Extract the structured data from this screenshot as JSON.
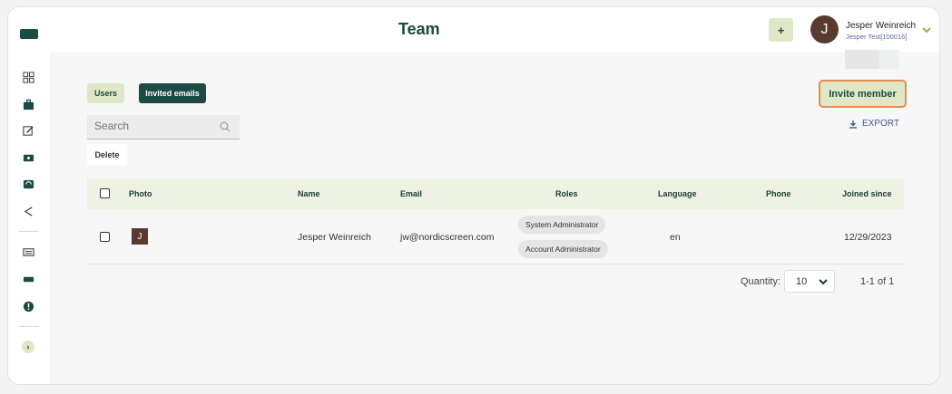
{
  "header": {
    "title": "Team",
    "add_label": "+",
    "user": {
      "initial": "J",
      "name": "Jesper Weinreich",
      "org": "Jesper Test[100016]"
    }
  },
  "sidebar": {
    "icons": [
      "dashboard-icon",
      "briefcase-icon",
      "edit-icon",
      "display-icon",
      "refresh-icon",
      "share-icon",
      "keyboard-icon",
      "rectangle-icon",
      "info-icon"
    ],
    "expand_label": "›"
  },
  "tabs": [
    {
      "label": "Users",
      "active": false
    },
    {
      "label": "Invited emails",
      "active": true
    }
  ],
  "actions": {
    "invite_label": "Invite member",
    "export_label": "EXPORT",
    "delete_label": "Delete"
  },
  "search": {
    "placeholder": "Search",
    "value": ""
  },
  "table": {
    "columns": [
      "Photo",
      "Name",
      "Email",
      "Roles",
      "Language",
      "Phone",
      "Joined since"
    ],
    "rows": [
      {
        "photo_initial": "J",
        "name": "Jesper Weinreich",
        "email": "jw@nordicscreen.com",
        "roles": [
          "System Administrator",
          "Account Administrator"
        ],
        "language": "en",
        "phone": "",
        "joined": "12/29/2023"
      }
    ]
  },
  "pagination": {
    "quantity_label": "Quantity:",
    "quantity_value": "10",
    "range": "1-1 of 1"
  },
  "colors": {
    "brand": "#1c4a44",
    "accent_light": "#dfe8c6",
    "highlight": "#e98b4c"
  }
}
